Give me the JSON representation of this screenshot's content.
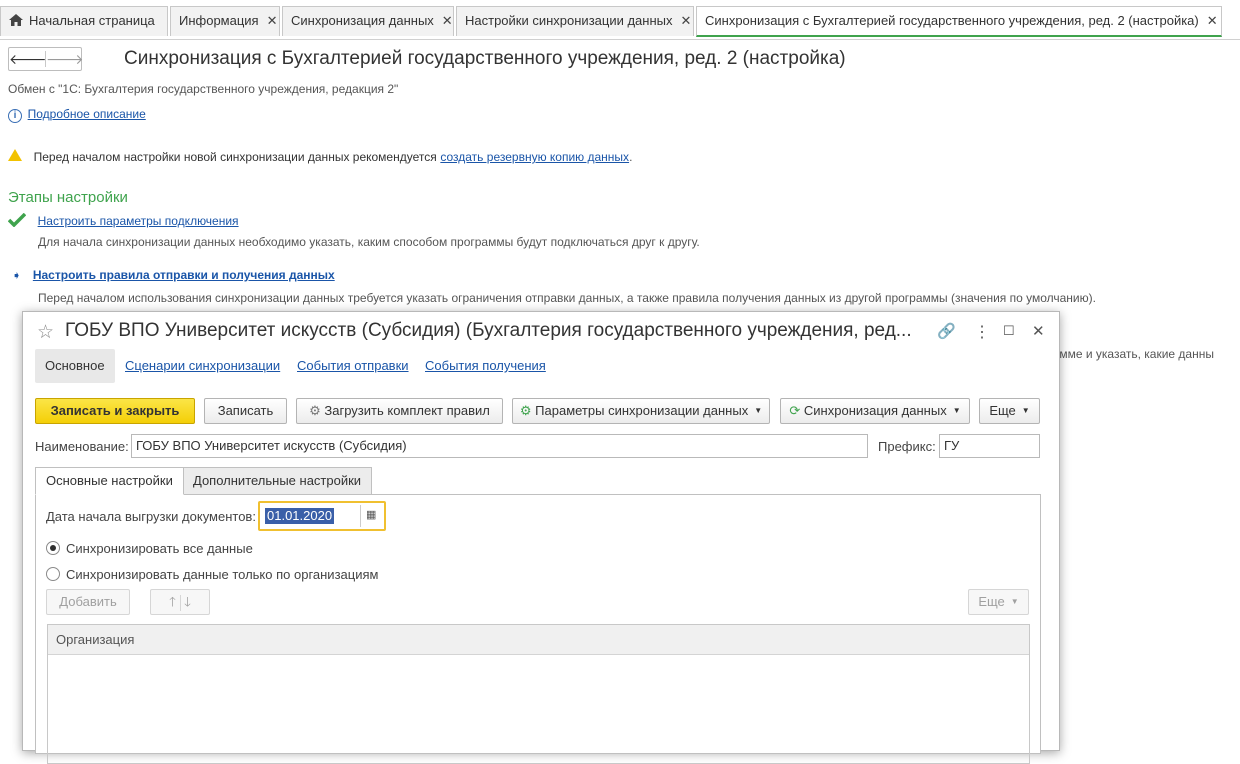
{
  "tabs": [
    {
      "label": "Начальная страница",
      "closable": false
    },
    {
      "label": "Информация",
      "closable": true
    },
    {
      "label": "Синхронизация данных",
      "closable": true
    },
    {
      "label": "Настройки синхронизации данных",
      "closable": true
    },
    {
      "label": "Синхронизация с Бухгалтерией государственного учреждения, ред. 2 (настройка)",
      "closable": true,
      "active": true
    }
  ],
  "nav": {
    "back": "🡐",
    "forward": "🡒"
  },
  "page": {
    "title": "Синхронизация с Бухгалтерией государственного учреждения, ред. 2 (настройка)",
    "exchange_with": "Обмен с \"1С: Бухгалтерия государственного учреждения, редакция 2\"",
    "details_link": "Подробное описание",
    "warning_text": "Перед началом настройки новой синхронизации данных рекомендуется",
    "warning_link": "создать резервную копию данных",
    "warning_end": "."
  },
  "stages": {
    "title": "Этапы настройки",
    "items": [
      {
        "link": "Настроить параметры подключения",
        "desc": "Для начала синхронизации данных необходимо указать, каким способом программы будут подключаться друг к другу.",
        "state": "done"
      },
      {
        "link": "Настроить правила отправки и получения данных",
        "desc": "Перед началом использования синхронизации данных требуется указать ограничения отправки данных, а также правила получения данных из другой программы (значения по умолчанию).",
        "state": "current"
      }
    ],
    "hidden_tail": "рамме и указать, какие данны"
  },
  "dialog": {
    "title": "ГОБУ ВПО Университет искусств (Субсидия) (Бухгалтерия государственного учреждения, ред...",
    "subtabs": [
      "Основное",
      "Сценарии синхронизации",
      "События отправки",
      "События получения"
    ],
    "buttons": {
      "save_close": "Записать и закрыть",
      "save": "Записать",
      "load_rules": "Загрузить комплект правил",
      "sync_params": "Параметры синхронизации данных",
      "sync_data": "Синхронизация данных",
      "more": "Еще"
    },
    "name_label": "Наименование:",
    "name_value": "ГОБУ ВПО Университет искусств (Субсидия)",
    "prefix_label": "Префикс:",
    "prefix_value": "ГУ",
    "inner_tabs": [
      "Основные настройки",
      "Дополнительные настройки"
    ],
    "date_label": "Дата начала выгрузки документов:",
    "date_value": "01.01.2020",
    "radio_all": "Синхронизировать все данные",
    "radio_orgs": "Синхронизировать данные только по организациям",
    "radio_selected": "all",
    "add_button": "Добавить",
    "more_button": "Еще",
    "grid_column": "Организация"
  }
}
